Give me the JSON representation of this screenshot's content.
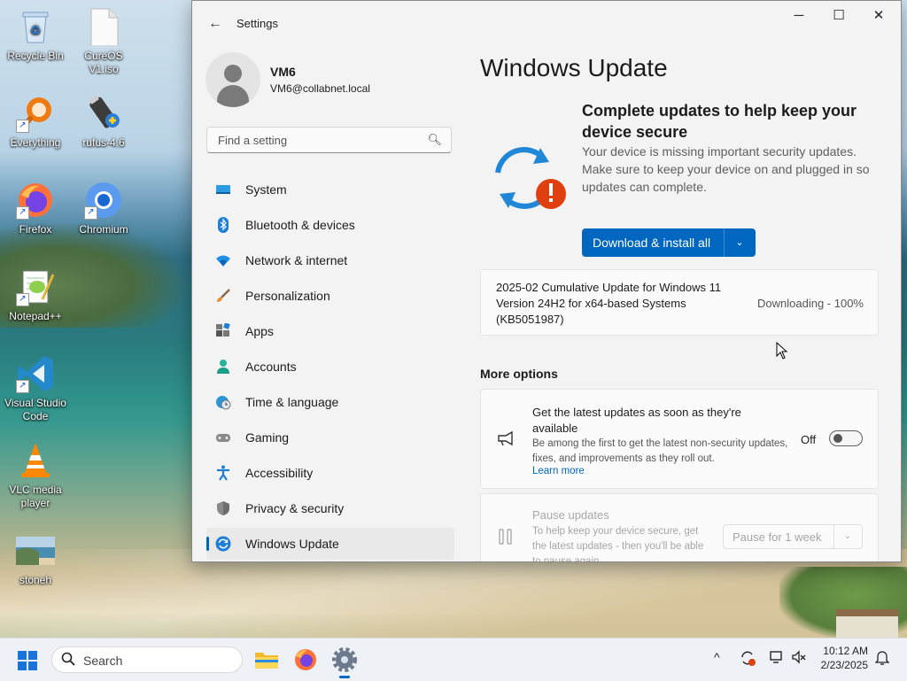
{
  "desktop": {
    "icons": [
      {
        "label": "Recycle Bin"
      },
      {
        "label": "CureOS V1.iso"
      },
      {
        "label": "Everything"
      },
      {
        "label": "rufus-4.6"
      },
      {
        "label": "Firefox"
      },
      {
        "label": "Chromium"
      },
      {
        "label": "Notepad++"
      },
      {
        "label": "Visual Studio Code"
      },
      {
        "label": "VLC media player"
      },
      {
        "label": "stoneh"
      }
    ]
  },
  "window": {
    "title": "Settings",
    "back_glyph": "←",
    "minimize_glyph": "─",
    "maximize_glyph": "☐",
    "close_glyph": "✕"
  },
  "account": {
    "name": "VM6",
    "email": "VM6@collabnet.local"
  },
  "search": {
    "placeholder": "Find a setting"
  },
  "nav": {
    "items": [
      {
        "label": "System",
        "icon": "monitor-icon"
      },
      {
        "label": "Bluetooth & devices",
        "icon": "bluetooth-icon"
      },
      {
        "label": "Network & internet",
        "icon": "wifi-icon"
      },
      {
        "label": "Personalization",
        "icon": "brush-icon"
      },
      {
        "label": "Apps",
        "icon": "apps-icon"
      },
      {
        "label": "Accounts",
        "icon": "person-icon"
      },
      {
        "label": "Time & language",
        "icon": "globe-clock-icon"
      },
      {
        "label": "Gaming",
        "icon": "gamepad-icon"
      },
      {
        "label": "Accessibility",
        "icon": "accessibility-icon"
      },
      {
        "label": "Privacy & security",
        "icon": "shield-icon"
      },
      {
        "label": "Windows Update",
        "icon": "update-icon",
        "selected": true
      }
    ]
  },
  "main": {
    "title": "Windows Update",
    "banner": {
      "title": "Complete updates to help keep your device secure",
      "description": "Your device is missing important security updates. Make sure to keep your device on and plugged in so updates can complete.",
      "button_label": "Download & install all",
      "dropdown_glyph": "⌄"
    },
    "update": {
      "name": "2025-02 Cumulative Update for Windows 11 Version 24H2 for x64-based Systems (KB5051987)",
      "status": "Downloading - 100%"
    },
    "more_options_label": "More options",
    "latest_updates": {
      "title": "Get the latest updates as soon as they're available",
      "description": "Be among the first to get the latest non-security updates, fixes, and improvements as they roll out.",
      "link": "Learn more",
      "toggle_label": "Off",
      "toggle_on": false
    },
    "pause": {
      "title": "Pause updates",
      "description": "To help keep your device secure, get the latest updates - then you'll be able to pause again.",
      "select_value": "Pause for 1 week"
    }
  },
  "taskbar": {
    "search_label": "Search",
    "time": "10:12 AM",
    "date": "2/23/2025"
  },
  "colors": {
    "accent": "#0067c0",
    "alert": "#e0400f"
  }
}
